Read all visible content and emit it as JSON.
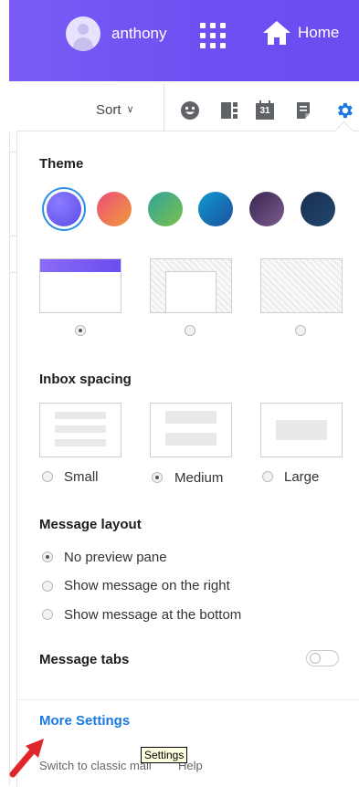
{
  "header": {
    "user_name": "anthony",
    "home_label": "Home"
  },
  "toolbar": {
    "sort_label": "Sort",
    "calendar_day": "31"
  },
  "settings": {
    "theme_heading": "Theme",
    "theme_swatches": [
      {
        "name": "purple",
        "color": "#6b5cf6",
        "selected": true
      },
      {
        "name": "sunset",
        "color": "#ef6c4e",
        "selected": false
      },
      {
        "name": "green",
        "color": "#3aa86a",
        "selected": false
      },
      {
        "name": "ocean",
        "color": "#1a82c4",
        "selected": false
      },
      {
        "name": "plum",
        "color": "#4b2f63",
        "selected": false
      },
      {
        "name": "navy",
        "color": "#1d3557",
        "selected": false
      }
    ],
    "theme_styles_selected_index": 0,
    "inbox_spacing_heading": "Inbox spacing",
    "spacing_options": [
      "Small",
      "Medium",
      "Large"
    ],
    "spacing_selected": "Medium",
    "message_layout_heading": "Message layout",
    "layout_options": [
      "No preview pane",
      "Show message on the right",
      "Show message at the bottom"
    ],
    "layout_selected": "No preview pane",
    "message_tabs_heading": "Message tabs",
    "message_tabs_on": false,
    "more_settings_label": "More Settings",
    "switch_classic_label": "Switch to classic mail",
    "help_label": "Help",
    "tooltip_text": "Settings"
  },
  "colors": {
    "header_purple": "#6e4ff2",
    "link_blue": "#1a7ae0",
    "gear_blue": "#1a7ae0",
    "arrow_red": "#e0262b"
  }
}
